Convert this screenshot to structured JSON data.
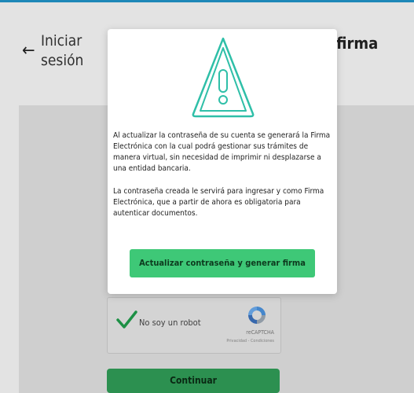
{
  "page": {
    "back_arrow": "←",
    "title_line1": "Iniciar",
    "title_line2": "sesión",
    "title_right_fragment": "r firma"
  },
  "captcha": {
    "label": "No soy un robot",
    "brand": "reCAPTCHA",
    "links": "Privacidad - Condiciones"
  },
  "form": {
    "continue_label": "Continuar"
  },
  "modal": {
    "icon": "warning-triangle-icon",
    "message_1": "Al actualizar la contraseña de su cuenta se generará la Firma Electrónica con la cual podrá gestionar sus trámites de manera virtual, sin necesidad de imprimir ni desplazarse a una entidad bancaria.",
    "message_2": "La contraseña creada le servirá para ingresar y como Firma Electrónica, que a partir de ahora es obligatoria para autenticar documentos.",
    "button_label": "Actualizar contraseña y generar firma"
  },
  "colors": {
    "accent_green": "#3ec877",
    "icon_teal": "#2fbfa8",
    "top_bar": "#1e88b8"
  }
}
